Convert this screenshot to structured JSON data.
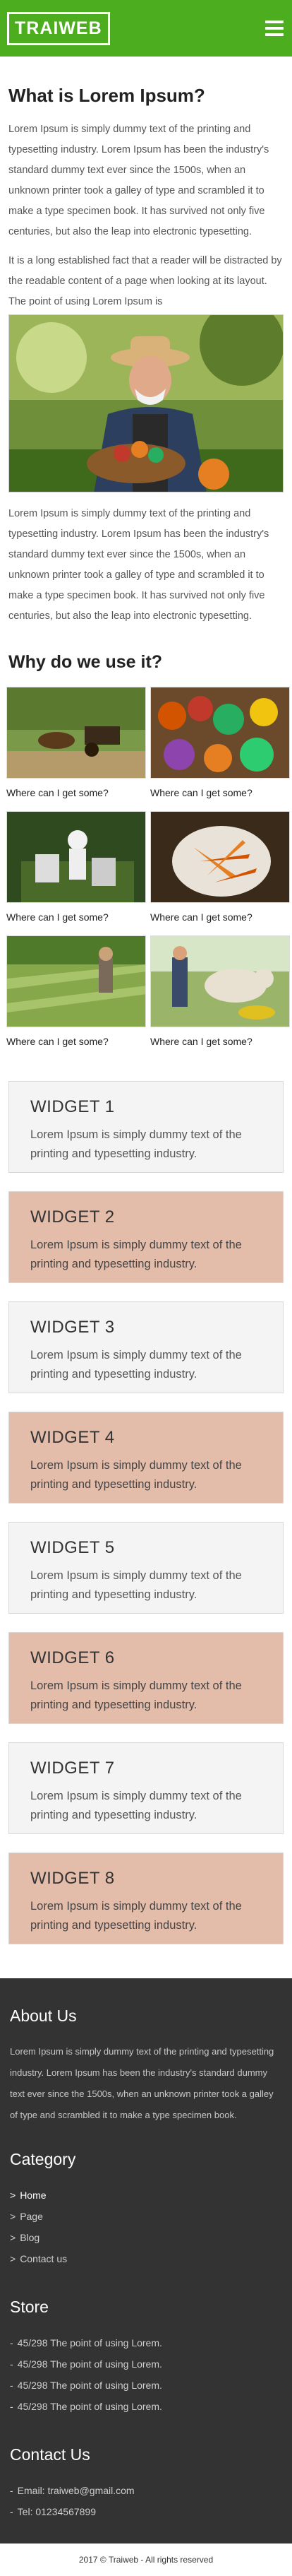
{
  "header": {
    "logo": "TRAIWEB",
    "menu_icon": "hamburger-icon"
  },
  "intro": {
    "title": "What is Lorem Ipsum?",
    "para1": "Lorem Ipsum is simply dummy text of the printing and typesetting industry. Lorem Ipsum has been the industry's standard dummy text ever since the 1500s, when an unknown printer took a galley of type and scrambled it to make a type specimen book. It has survived not only five centuries, but also the leap into electronic typesetting.",
    "para2": "It is a long established fact that a reader will be distracted by the readable content of a page when looking at its layout. The point of using Lorem Ipsum is",
    "para3": "Lorem Ipsum is simply dummy text of the printing and typesetting industry. Lorem Ipsum has been the industry's standard dummy text ever since the 1500s, when an unknown printer took a galley of type and scrambled it to make a type specimen book. It has survived not only five centuries, but also the leap into electronic typesetting."
  },
  "why": {
    "title": "Why do we use it?",
    "items": [
      {
        "caption": "Where can I get some?"
      },
      {
        "caption": "Where can I get some?"
      },
      {
        "caption": "Where can I get some?"
      },
      {
        "caption": "Where can I get some?"
      },
      {
        "caption": "Where can I get some?"
      },
      {
        "caption": "Where can I get some?"
      }
    ]
  },
  "widgets": [
    {
      "title": "WIDGET 1",
      "text": "Lorem Ipsum is simply dummy text of the printing and typesetting industry."
    },
    {
      "title": "WIDGET 2",
      "text": "Lorem Ipsum is simply dummy text of the printing and typesetting industry."
    },
    {
      "title": "WIDGET 3",
      "text": "Lorem Ipsum is simply dummy text of the printing and typesetting industry."
    },
    {
      "title": "WIDGET 4",
      "text": "Lorem Ipsum is simply dummy text of the printing and typesetting industry."
    },
    {
      "title": "WIDGET 5",
      "text": "Lorem Ipsum is simply dummy text of the printing and typesetting industry."
    },
    {
      "title": "WIDGET 6",
      "text": "Lorem Ipsum is simply dummy text of the printing and typesetting industry."
    },
    {
      "title": "WIDGET 7",
      "text": "Lorem Ipsum is simply dummy text of the printing and typesetting industry."
    },
    {
      "title": "WIDGET 8",
      "text": "Lorem Ipsum is simply dummy text of the printing and typesetting industry."
    }
  ],
  "footer": {
    "about_title": "About Us",
    "about_text": "Lorem Ipsum is simply dummy text of the printing and typesetting industry. Lorem Ipsum has been the industry's standard dummy text ever since the 1500s, when an unknown printer took a galley of type and scrambled it to make a type specimen book.",
    "category_title": "Category",
    "categories": [
      "Home",
      "Page",
      "Blog",
      "Contact us"
    ],
    "store_title": "Store",
    "store_items": [
      "45/298 The point of using Lorem.",
      "45/298 The point of using Lorem.",
      "45/298 The point of using Lorem.",
      "45/298 The point of using Lorem."
    ],
    "contact_title": "Contact Us",
    "email": "Email: traiweb@gmail.com",
    "tel": "Tel: 01234567899",
    "copyright": "2017 © Traiweb - All rights reserved"
  },
  "colors": {
    "brand": "#4cae1e",
    "widget_alt": "#e4bcaa",
    "footer_bg": "#333333"
  }
}
